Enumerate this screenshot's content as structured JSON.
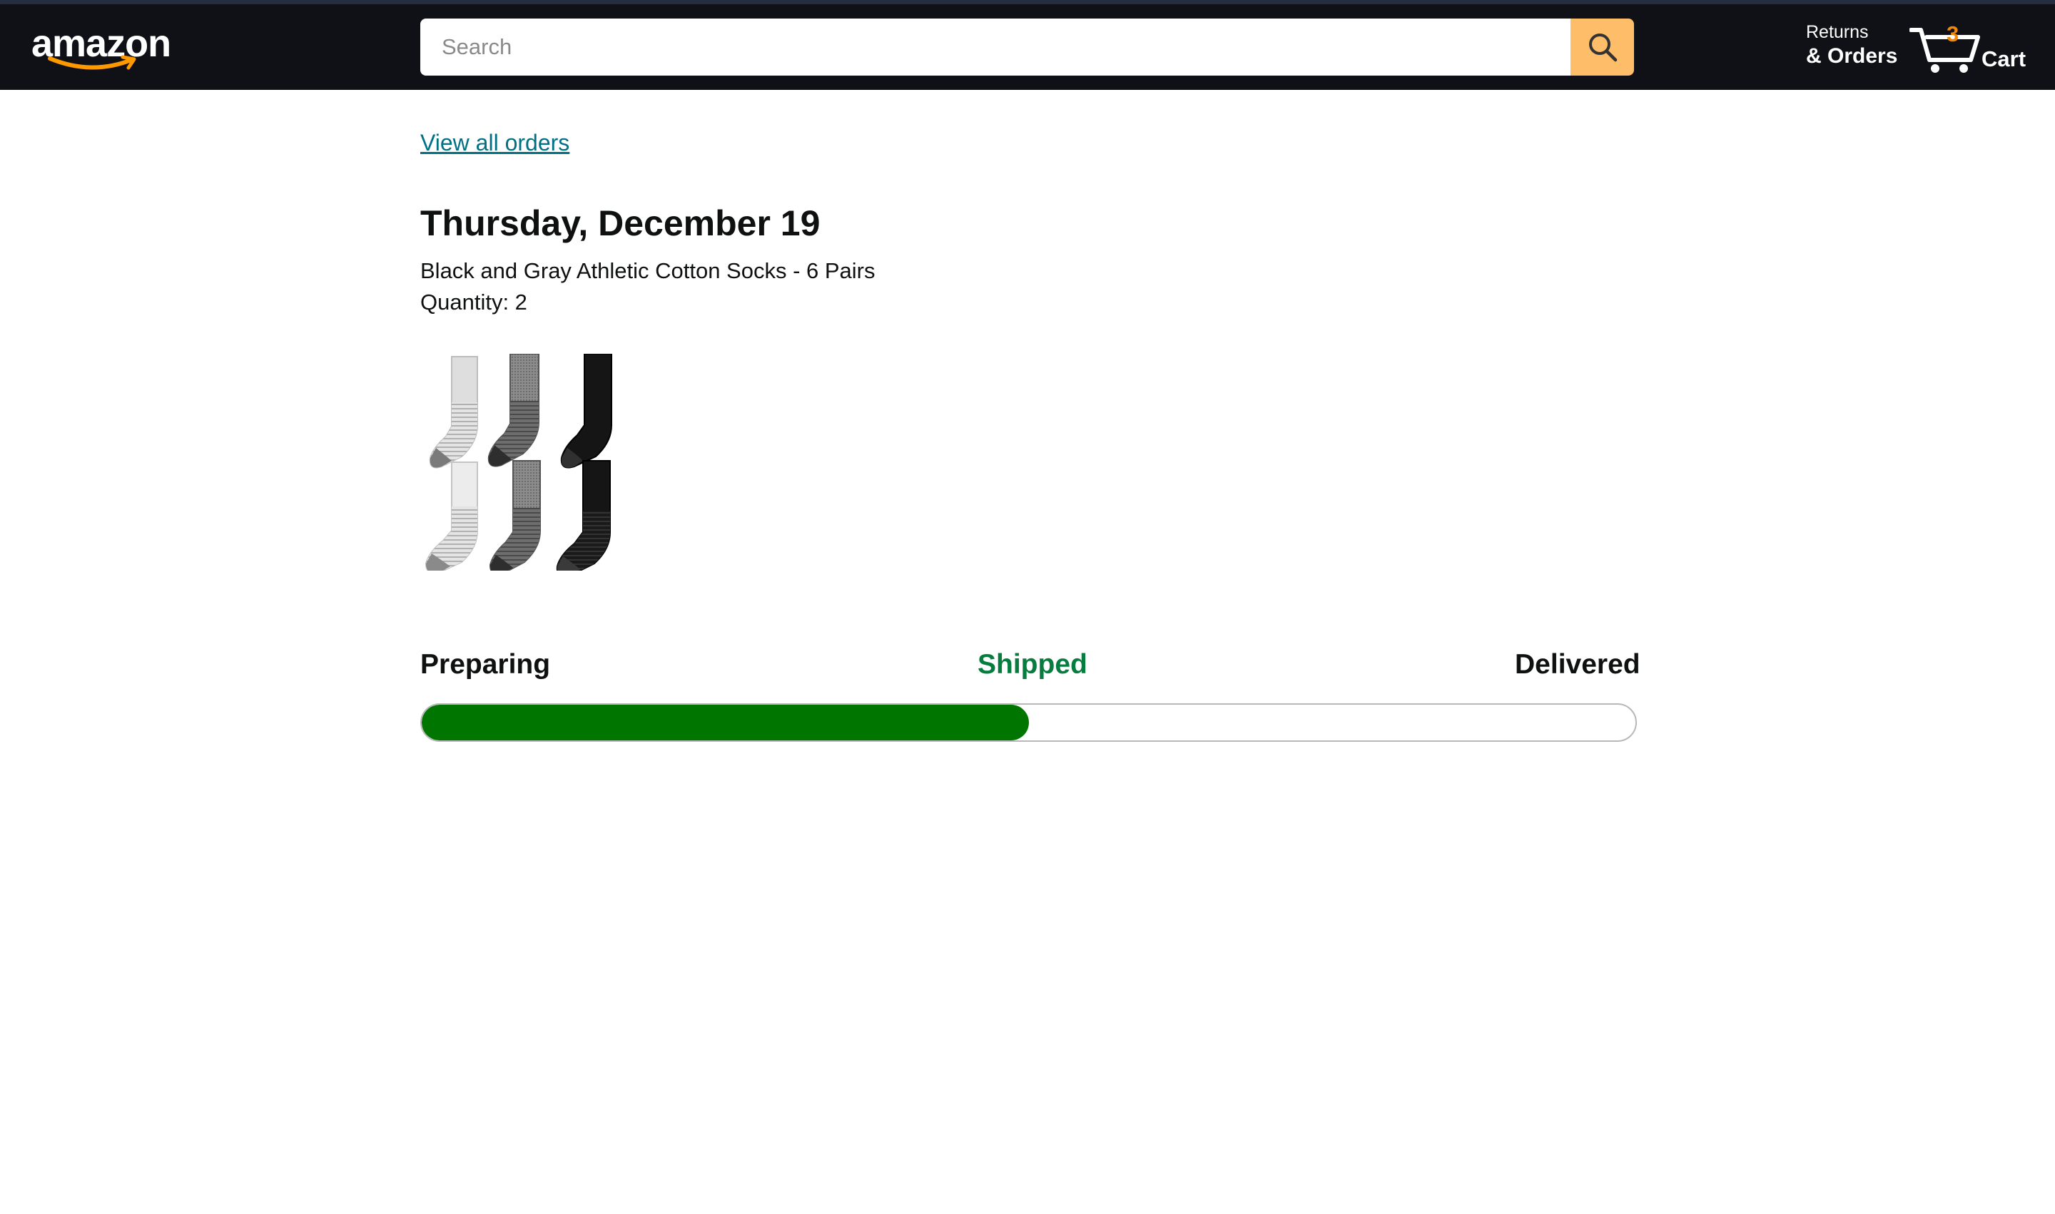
{
  "header": {
    "logo_text": "amazon",
    "search_placeholder": "Search",
    "returns_top": "Returns",
    "returns_bottom": "& Orders",
    "cart_count": "3",
    "cart_label": "Cart"
  },
  "order": {
    "view_all_label": "View all orders",
    "date": "Thursday, December 19",
    "product_name": "Black and Gray Athletic Cotton Socks - 6 Pairs",
    "quantity": "Quantity: 2"
  },
  "tracking": {
    "steps": [
      "Preparing",
      "Shipped",
      "Delivered"
    ],
    "current_step": "Shipped",
    "progress_fraction": 0.5
  },
  "colors": {
    "header_bg": "#0f1117",
    "search_button": "#febd69",
    "link": "#007185",
    "shipped_text": "#067d3f",
    "progress_fill": "#007600",
    "cart_count": "#f08804"
  },
  "icons": {
    "search_button": "search-icon",
    "cart": "cart-icon",
    "logo_swoosh": "smile-arrow-icon"
  }
}
